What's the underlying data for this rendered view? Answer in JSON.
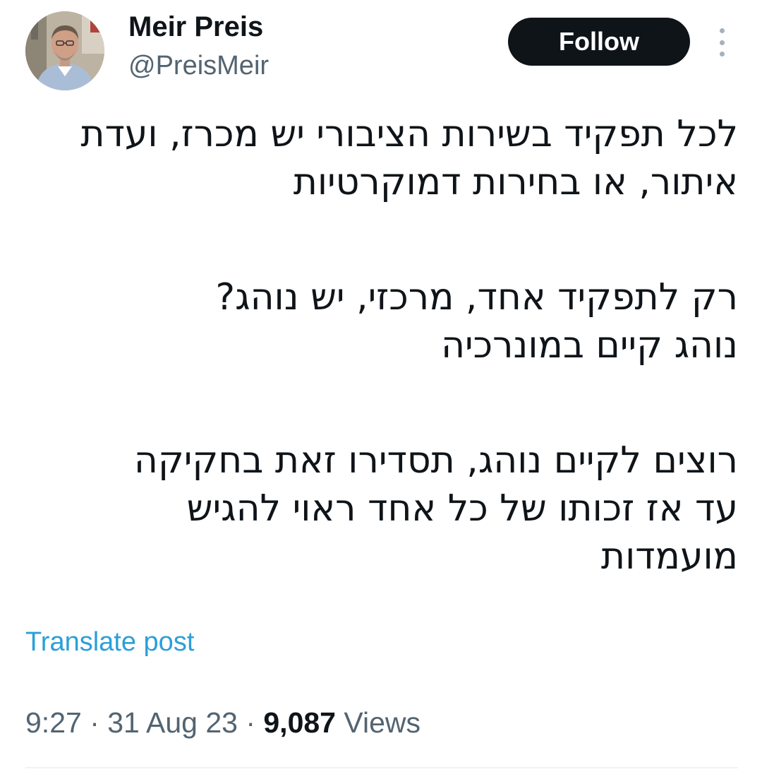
{
  "author": {
    "name": "Meir Preis",
    "handle": "@PreisMeir",
    "avatar_icon": "profile-photo"
  },
  "actions": {
    "follow_label": "Follow",
    "more_icon": "vertical-ellipsis-icon"
  },
  "tweet": {
    "paragraphs": [
      {
        "lines": [
          "לכל תפקיד בשירות הציבורי יש מכרז, ועדת",
          "איתור, או בחירות דמוקרטיות"
        ]
      },
      {
        "lines": [
          "רק לתפקיד אחד, מרכזי, יש נוהג?",
          "נוהג קיים במונרכיה"
        ]
      },
      {
        "lines": [
          "רוצים לקיים נוהג, תסדירו זאת בחקיקה",
          "עד אז זכותו של כל אחד ראוי להגיש",
          "מועמדות"
        ]
      }
    ],
    "translate_label": "Translate post"
  },
  "meta": {
    "time": "9:27",
    "separator": " · ",
    "date": "31 Aug 23",
    "views_count": "9,087",
    "views_label": "Views"
  },
  "colors": {
    "text_primary": "#0f1419",
    "text_secondary": "#536471",
    "link": "#2b9fd9",
    "follow_bg": "#0f1419",
    "follow_text": "#ffffff",
    "divider": "#eff3f4"
  }
}
